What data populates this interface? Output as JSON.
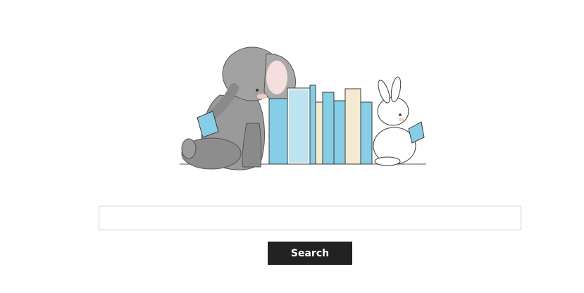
{
  "hero": {
    "illustration": "elephant-and-bunny-reading-between-books",
    "colors": {
      "elephant": "#8f8f8f",
      "book_blue": "#86cde6",
      "book_cream": "#f3ead0",
      "ink": "#3a3a3a"
    }
  },
  "search": {
    "value": "",
    "placeholder": "",
    "button_label": "Search"
  }
}
